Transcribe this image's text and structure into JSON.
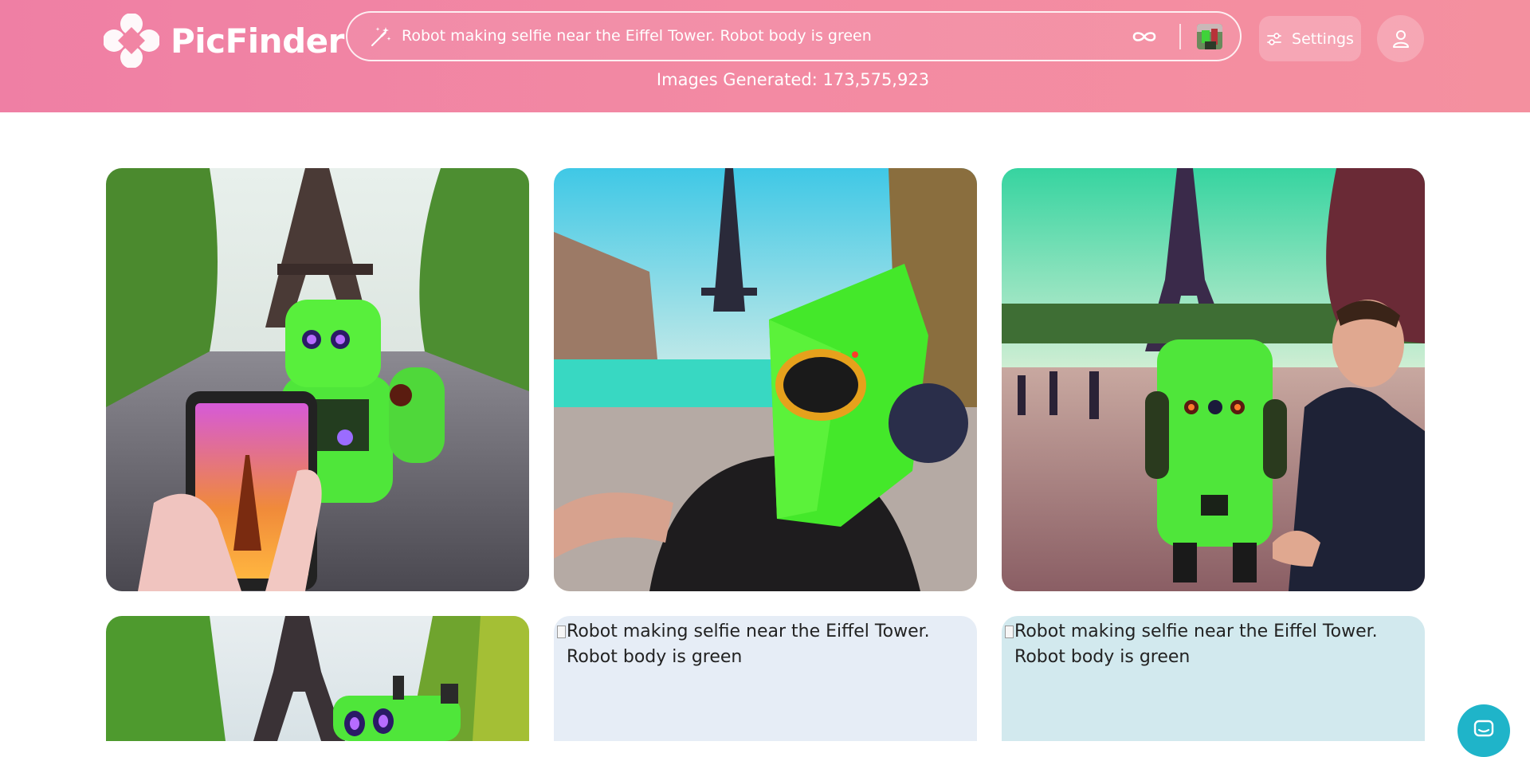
{
  "brand": {
    "name": "PicFinder",
    "color": "#ffffff"
  },
  "header": {
    "gradient_start": "#ef7fa4",
    "gradient_end": "#f4909f"
  },
  "search": {
    "value": "Robot making selfie near the Eiffel Tower. Robot body is green",
    "left_icon": "magic-wand-icon",
    "infinite_icon": "infinity-icon",
    "thumbnail_icon": "image-thumbnail-icon"
  },
  "settings": {
    "label": "Settings",
    "icon": "sliders-icon"
  },
  "user": {
    "icon": "user-icon"
  },
  "stats": {
    "images_generated": "Images Generated: 173,575,923"
  },
  "gallery": {
    "image_alt": "Robot making selfie near the Eiffel Tower. Robot body is green",
    "placeholder_color_1": "#e6edf6",
    "placeholder_color_2": "#d2e9ee"
  },
  "chat": {
    "icon": "chat-icon",
    "color": "#1fb4c9"
  }
}
